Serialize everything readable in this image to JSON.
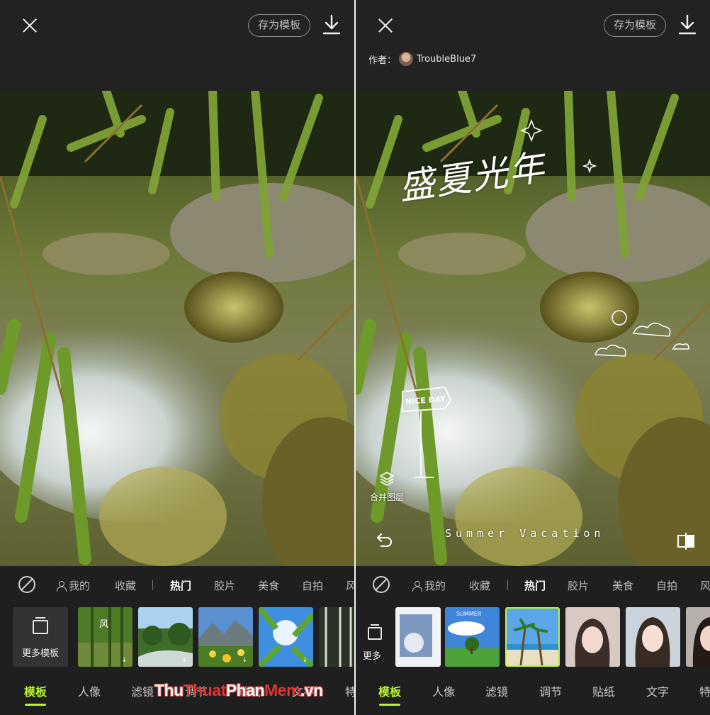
{
  "left_panel": {
    "header": {
      "save_template_label": "存为模板"
    },
    "categories": [
      "我的",
      "收藏",
      "热门",
      "胶片",
      "美食",
      "自拍",
      "风"
    ],
    "active_category": "热门",
    "more_templates_label": "更多模板",
    "bottom_tabs": [
      "模板",
      "人像",
      "滤镜",
      "调节",
      "贴纸",
      "文字",
      "特"
    ],
    "active_tab": "模板"
  },
  "right_panel": {
    "header": {
      "save_template_label": "存为模板"
    },
    "author_label": "作者：",
    "author_name": "TroubleBlue7",
    "overlay": {
      "title_text": "盛夏光年",
      "signpost_text": "NICE DAY",
      "caption_text": "Summer Vacation",
      "merge_layer_label": "合并图层"
    },
    "categories": [
      "我的",
      "收藏",
      "热门",
      "胶片",
      "美食",
      "自拍",
      "风"
    ],
    "active_category": "热门",
    "more_label": "更多",
    "template_thumbnail_text": "SUMMER",
    "bottom_tabs": [
      "模板",
      "人像",
      "滤镜",
      "调节",
      "贴纸",
      "文字",
      "特"
    ],
    "active_tab": "模板"
  },
  "watermark": {
    "part1": "Thu",
    "part2": "Thuat",
    "part3": "Phan",
    "part4": "Mem",
    "part5": ".vn"
  },
  "colors": {
    "accent": "#b9f23b",
    "background": "#1f1f1f",
    "header": "#222222",
    "watermark_red": "#e43434"
  },
  "icons": [
    "close-icon",
    "download-icon",
    "no-filter-icon",
    "person-icon",
    "layers-icon",
    "undo-icon",
    "compare-icon"
  ]
}
